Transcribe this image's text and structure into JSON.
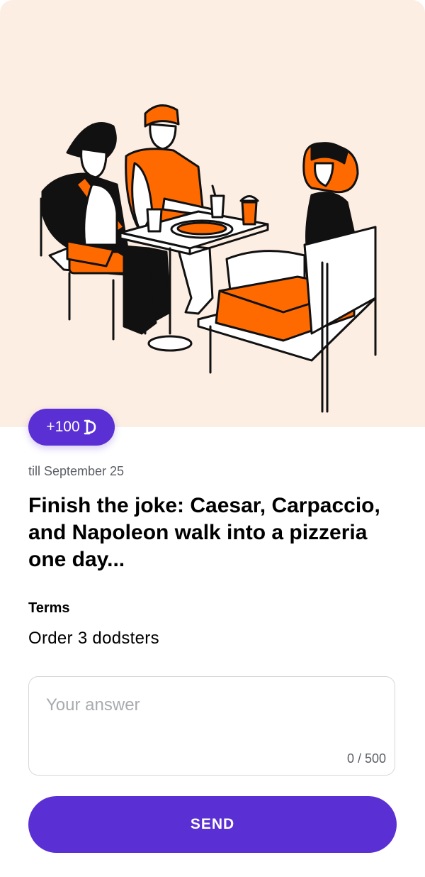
{
  "card": {
    "reward": "+100",
    "reward_icon": "dodo-coin-icon",
    "deadline": "till September 25",
    "title": "Finish the joke: Caesar, Carpaccio, and Napoleon walk into a pizzeria one day...",
    "terms_label": "Terms",
    "terms_value": "Order 3 dodsters"
  },
  "answer": {
    "value": "",
    "placeholder": "Your answer",
    "counter": "0 / 500"
  },
  "send_button": {
    "label": "SEND"
  },
  "colors": {
    "accent": "#5a2fd3",
    "hero_background": "#fdeee3",
    "illustration_orange": "#ff6a00"
  }
}
